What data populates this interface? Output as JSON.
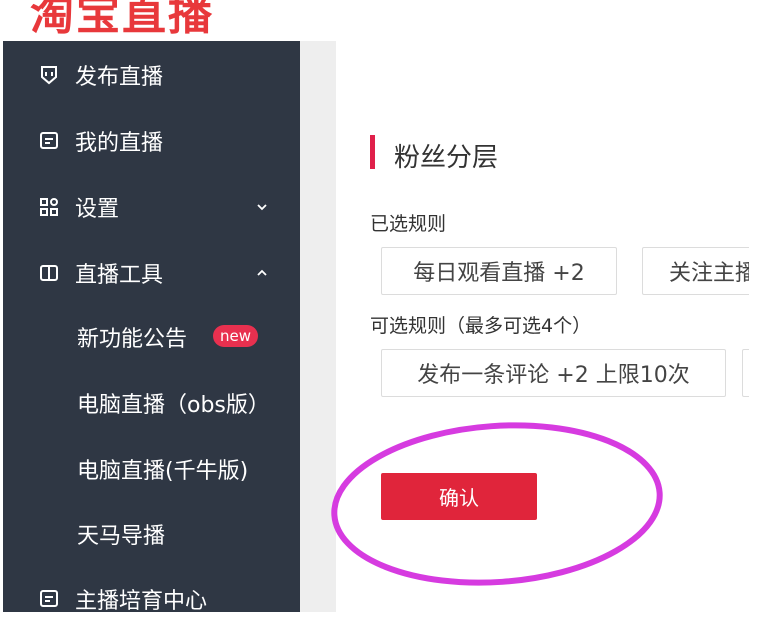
{
  "header": {
    "logo_text": "淘宝直播"
  },
  "sidebar": {
    "items": [
      {
        "label": "发布直播",
        "icon": "shield-icon"
      },
      {
        "label": "我的直播",
        "icon": "document-icon"
      },
      {
        "label": "设置",
        "icon": "grid-icon",
        "chevron": "chevron-down-icon"
      },
      {
        "label": "直播工具",
        "icon": "book-icon",
        "chevron": "chevron-up-icon"
      }
    ],
    "sub_items": [
      {
        "label": "新功能公告",
        "badge": "new"
      },
      {
        "label": "电脑直播（obs版）"
      },
      {
        "label": "电脑直播(千牛版)"
      },
      {
        "label": "天马导播"
      }
    ],
    "bottom_item": {
      "label": "主播培育中心",
      "icon": "document-icon"
    }
  },
  "main": {
    "title": "粉丝分层",
    "selected_rules_label": "已选规则",
    "selected_rules": [
      "每日观看直播 +2",
      "关注主播"
    ],
    "available_rules_label": "可选规则（最多可选4个）",
    "available_rules": [
      "发布一条评论 +2 上限10次"
    ],
    "confirm_label": "确认"
  },
  "colors": {
    "sidebar_bg": "#2f3744",
    "accent": "#e0253b",
    "annotation": "#d63be0"
  }
}
